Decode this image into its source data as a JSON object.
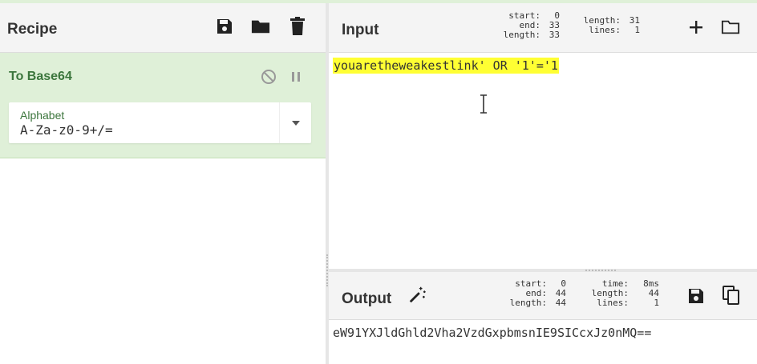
{
  "recipe": {
    "title": "Recipe",
    "icons": [
      "save-icon",
      "folder-icon",
      "trash-icon"
    ],
    "operation": {
      "name": "To Base64",
      "controls": [
        "disable-icon",
        "pause-icon"
      ],
      "argument": {
        "label": "Alphabet",
        "value": "A-Za-z0-9+/="
      }
    }
  },
  "input": {
    "title": "Input",
    "stats": {
      "start_label": "start:",
      "start": "0",
      "end_label": "end:",
      "end": "33",
      "length_sel_label": "length:",
      "length_sel": "33",
      "length_label": "length:",
      "length": "31",
      "lines_label": "lines:",
      "lines": "1"
    },
    "text": "youaretheweakestlink' OR '1'='1",
    "icons": [
      "plus-icon",
      "open-folder-icon"
    ]
  },
  "output": {
    "title": "Output",
    "stats": {
      "start_label": "start:",
      "start": "0",
      "end_label": "end:",
      "end": "44",
      "length_sel_label": "length:",
      "length_sel": "44",
      "time_label": "time:",
      "time": "8ms",
      "length_label": "length:",
      "length": "44",
      "lines_label": "lines:",
      "lines": "1"
    },
    "text": "eW91YXJldGhld2Vha2VzdGxpbmsnIE9SICcxJz0nMQ==",
    "icons": [
      "magic-wand-icon",
      "save-icon",
      "copy-icon"
    ]
  },
  "colors": {
    "operation_bg": "#dff0d8",
    "operation_text": "#3c763d",
    "highlight": "#ffff33"
  }
}
